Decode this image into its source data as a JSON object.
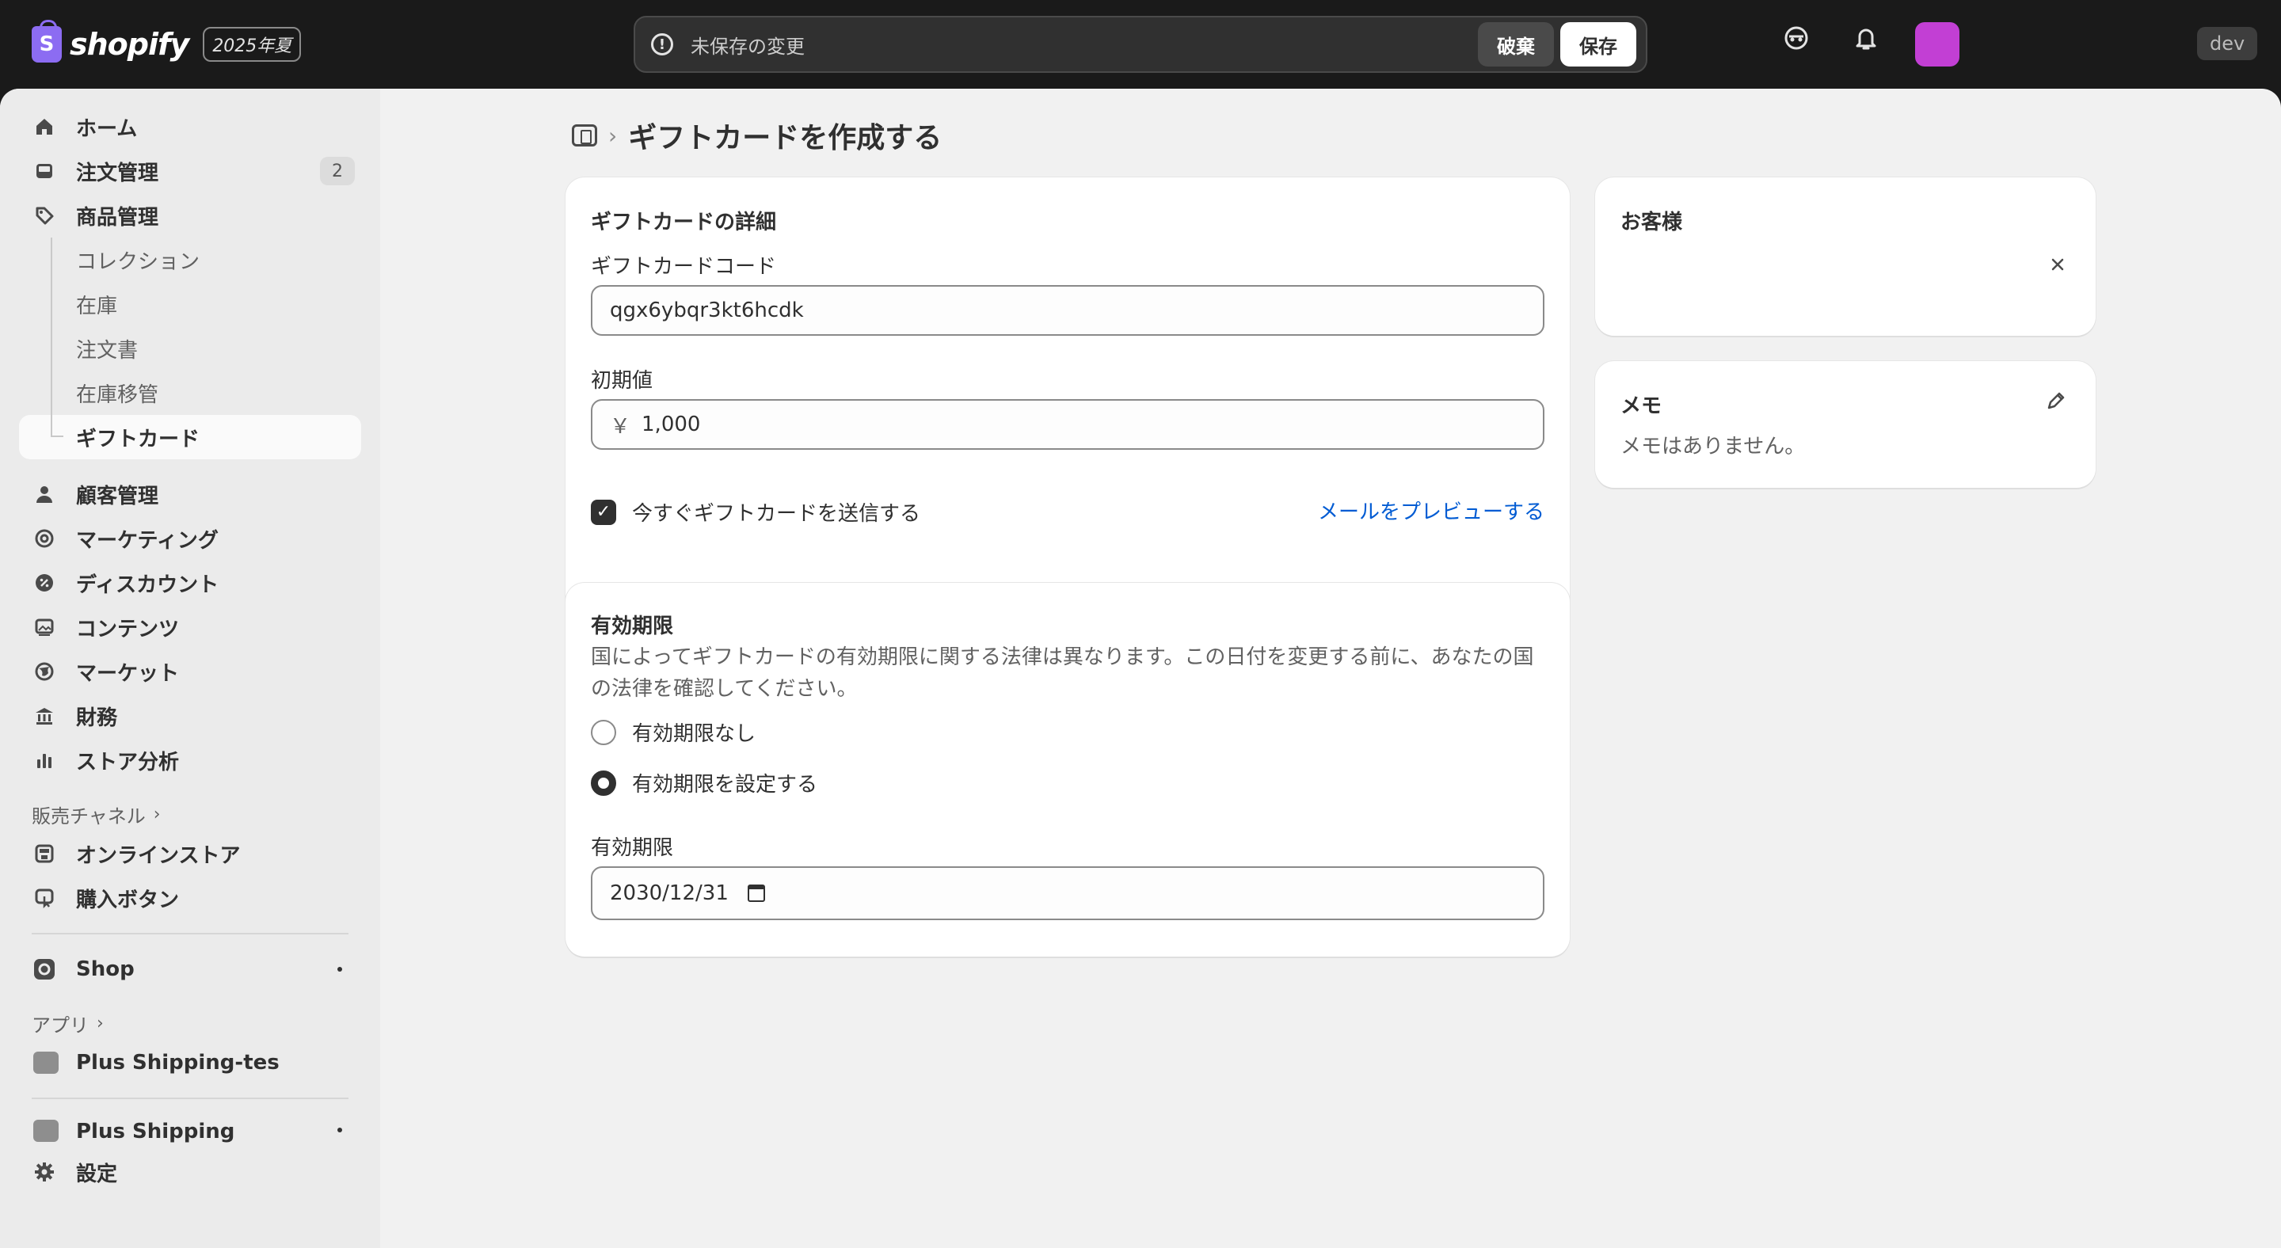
{
  "topbar": {
    "logo_text": "shopify",
    "edition_badge": "2025年夏",
    "savebar_message": "未保存の変更",
    "discard_label": "破棄",
    "save_label": "保存",
    "env_badge": "dev",
    "avatar_color": "#c23fd4"
  },
  "sidebar": {
    "items": [
      {
        "label": "ホーム",
        "icon": "home-icon"
      },
      {
        "label": "注文管理",
        "icon": "inbox-icon",
        "count": "2"
      },
      {
        "label": "商品管理",
        "icon": "tag-icon"
      }
    ],
    "product_sub": [
      "コレクション",
      "在庫",
      "注文書",
      "在庫移管",
      "ギフトカード"
    ],
    "items2": [
      {
        "label": "顧客管理",
        "icon": "person-icon"
      },
      {
        "label": "マーケティング",
        "icon": "target-icon"
      },
      {
        "label": "ディスカウント",
        "icon": "discount-icon"
      },
      {
        "label": "コンテンツ",
        "icon": "image-icon"
      },
      {
        "label": "マーケット",
        "icon": "globe-icon"
      },
      {
        "label": "財務",
        "icon": "bank-icon"
      },
      {
        "label": "ストア分析",
        "icon": "chart-icon"
      }
    ],
    "sales_channels_label": "販売チャネル",
    "channels": [
      "オンラインストア",
      "購入ボタン"
    ],
    "shop_label": "Shop",
    "apps_label": "アプリ",
    "apps": [
      "Plus Shipping-tes",
      "Plus Shipping"
    ],
    "settings_label": "設定"
  },
  "main": {
    "page_title": "ギフトカードを作成する",
    "details": {
      "title": "ギフトカードの詳細",
      "code_label": "ギフトカードコード",
      "code_value": "qgx6ybqr3kt6hcdk",
      "initial_label": "初期値",
      "currency": "￥",
      "initial_value": "1,000",
      "send_now_label": "今すぐギフトカードを送信する",
      "preview_link": "メールをプレビューする"
    },
    "expiry": {
      "title": "有効期限",
      "help": "国によってギフトカードの有効期限に関する法律は異なります。この日付を変更する前に、あなたの国の法律を確認してください。",
      "option_none": "有効期限なし",
      "option_set": "有効期限を設定する",
      "date_label": "有効期限",
      "date_value": "2030/12/31"
    },
    "customer": {
      "title": "お客様"
    },
    "memo": {
      "title": "メモ",
      "empty": "メモはありません。"
    }
  }
}
